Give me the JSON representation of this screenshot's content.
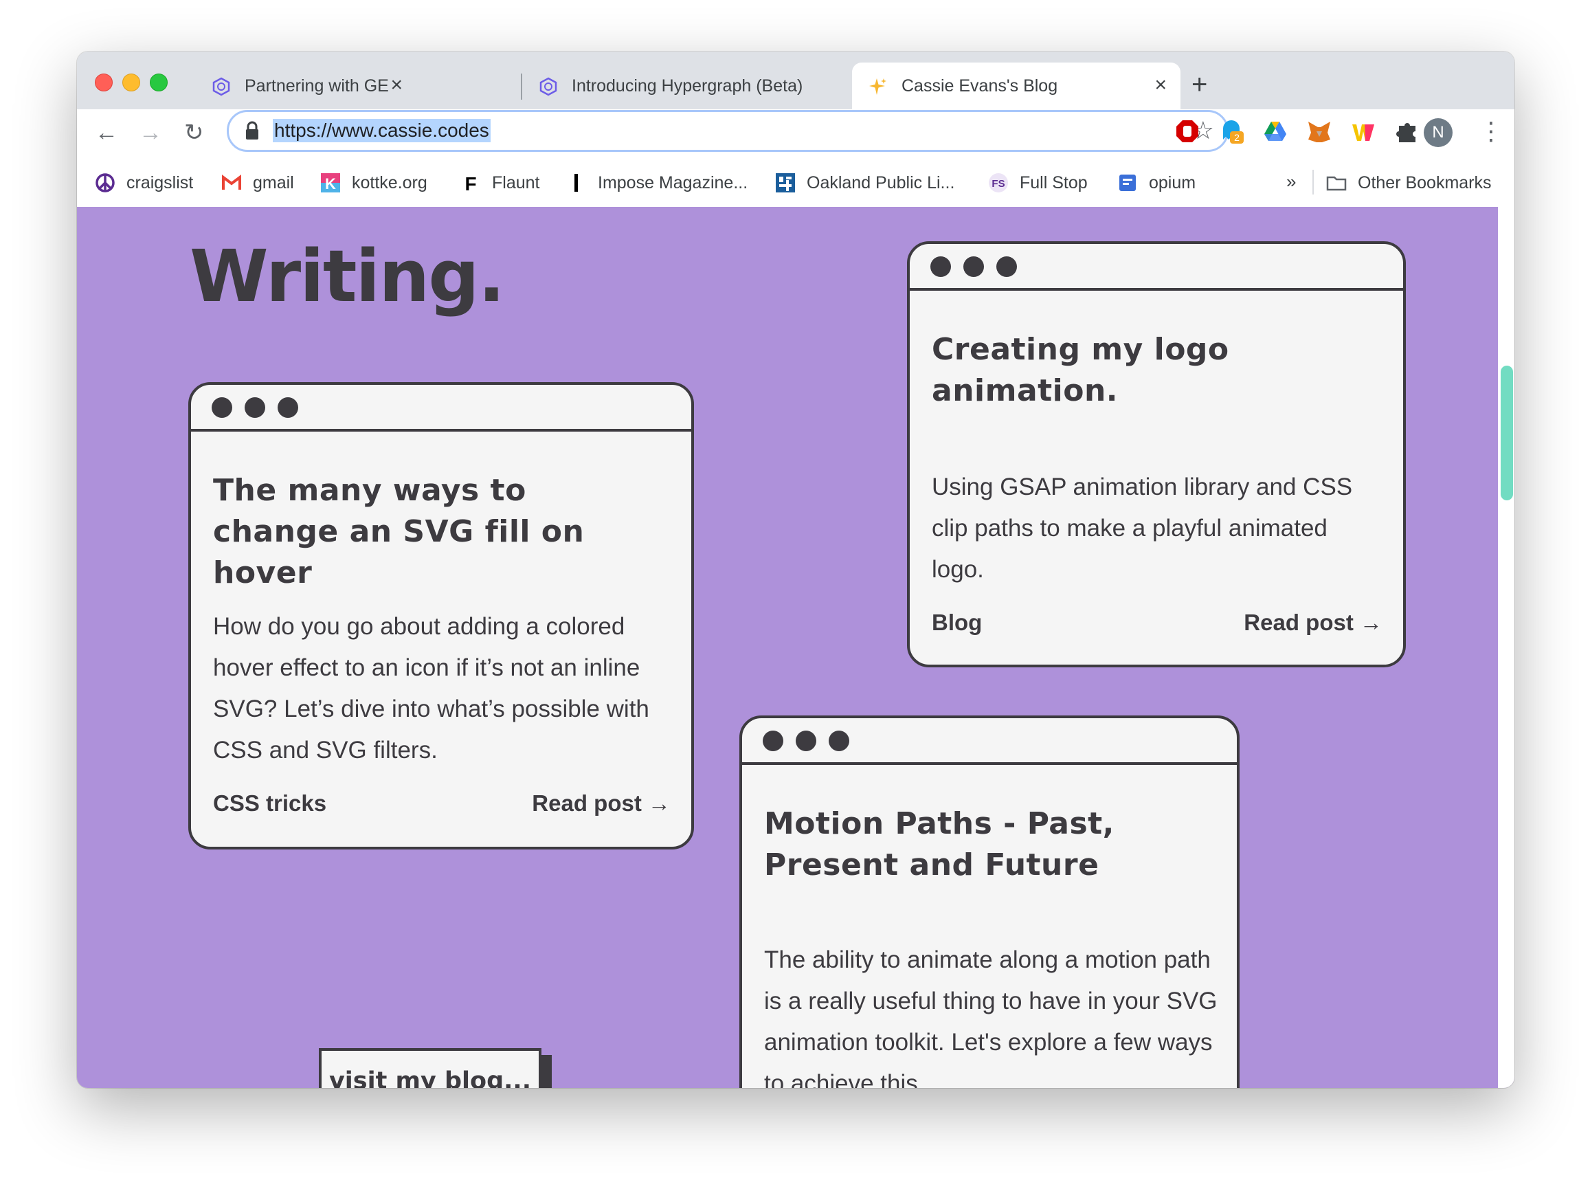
{
  "tabs": [
    {
      "title": "Partnering with GEUT",
      "icon": "hypergraph-icon"
    },
    {
      "title": "Introducing Hypergraph (Beta)",
      "icon": "hypergraph-icon"
    },
    {
      "title": "Cassie Evans's Blog",
      "icon": "sparkle-icon"
    }
  ],
  "address": {
    "url": "https://www.cassie.codes"
  },
  "bookmarks": [
    {
      "label": "craigslist",
      "icon": "peace-icon"
    },
    {
      "label": "gmail",
      "icon": "gmail-icon"
    },
    {
      "label": "kottke.org",
      "icon": "kottke-icon"
    },
    {
      "label": "Flaunt",
      "icon": "flaunt-icon"
    },
    {
      "label": "Impose Magazine...",
      "icon": "impose-icon"
    },
    {
      "label": "Oakland Public Li...",
      "icon": "library-icon"
    },
    {
      "label": "Full Stop",
      "icon": "fullstop-icon"
    },
    {
      "label": "opium",
      "icon": "opium-icon"
    }
  ],
  "bookmarks_more": "»",
  "other_bookmarks": "Other Bookmarks",
  "extensions": {
    "badge_count": "2",
    "avatar_initial": "N"
  },
  "page": {
    "heading": "Writing.",
    "cards": [
      {
        "title": "The many ways to change an SVG fill on hover",
        "description": "How do you go about adding a colored hover effect to an icon if it’s not an inline SVG? Let’s dive into what’s possible with CSS and SVG filters.",
        "tag": "CSS tricks",
        "read": "Read post →"
      },
      {
        "title": "Creating my logo animation.",
        "description": "Using GSAP animation library and CSS clip paths to make a playful animated logo.",
        "tag": "Blog",
        "read": "Read post →"
      },
      {
        "title": "Motion Paths - Past, Present and Future",
        "description": "The ability to animate along a motion path is a really useful thing to have in your SVG animation toolkit. Let's explore a few ways to achieve this."
      }
    ],
    "blog_button": "visit my blog..."
  },
  "colors": {
    "page_background": "#ae91da",
    "card_background": "#f5f5f5",
    "ink": "#3d3b40",
    "scrollbar_thumb": "#72dcc2"
  }
}
